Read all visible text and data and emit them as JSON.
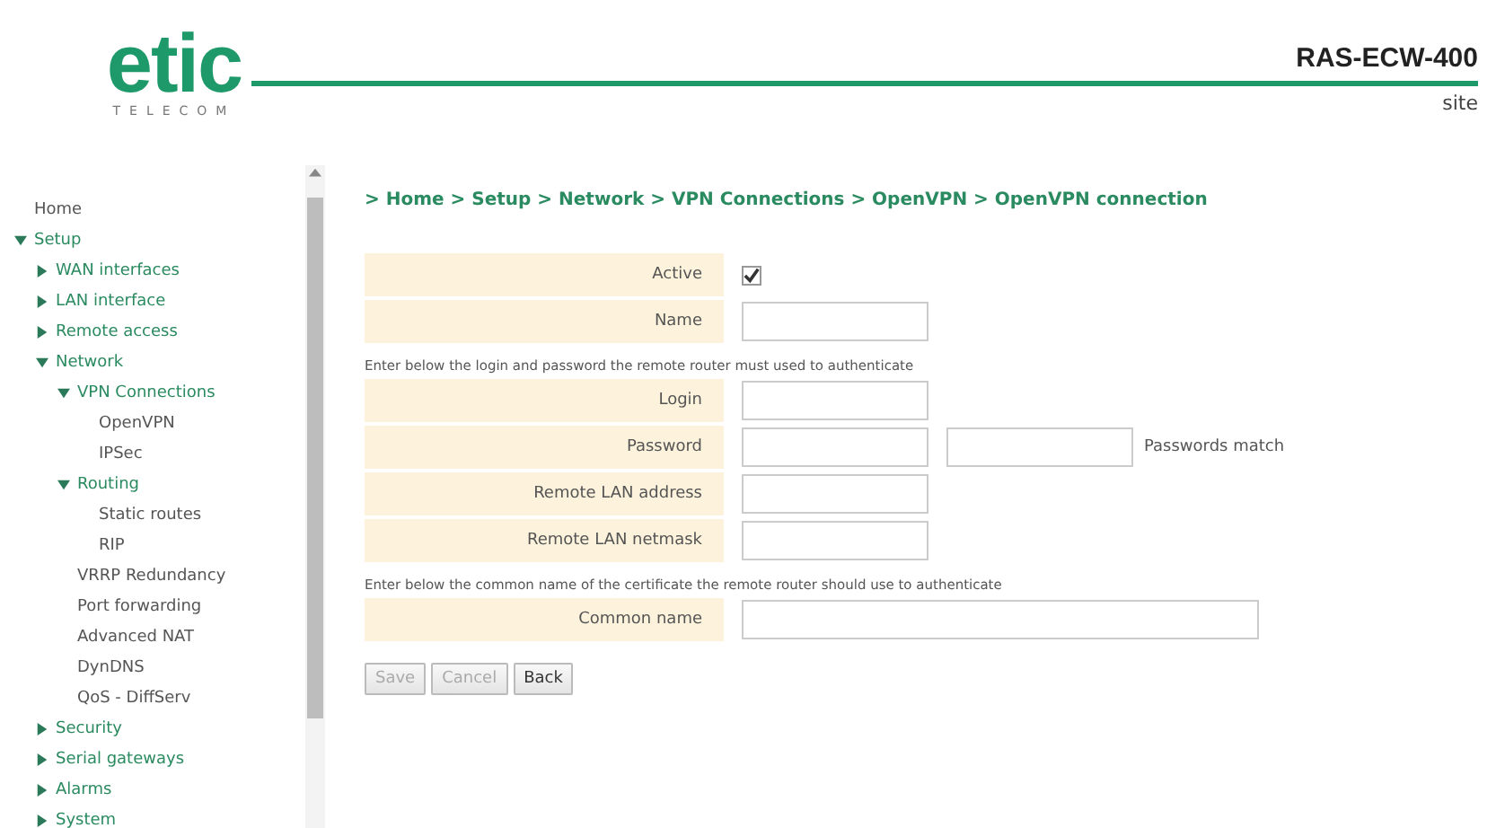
{
  "header": {
    "logo": {
      "word": "etic",
      "subtitle": "TELECOM"
    },
    "device": "RAS-ECW-400",
    "site": "site"
  },
  "sidebar": {
    "items": [
      {
        "label": "Home",
        "kind": "page"
      },
      {
        "label": "Setup",
        "kind": "folder",
        "expanded": true,
        "children": [
          {
            "label": "WAN interfaces",
            "kind": "folder",
            "expanded": false
          },
          {
            "label": "LAN interface",
            "kind": "folder",
            "expanded": false
          },
          {
            "label": "Remote access",
            "kind": "folder",
            "expanded": false
          },
          {
            "label": "Network",
            "kind": "folder",
            "expanded": true,
            "children": [
              {
                "label": "VPN Connections",
                "kind": "folder",
                "expanded": true,
                "children": [
                  {
                    "label": "OpenVPN",
                    "kind": "page"
                  },
                  {
                    "label": "IPSec",
                    "kind": "page"
                  }
                ]
              },
              {
                "label": "Routing",
                "kind": "folder",
                "expanded": true,
                "children": [
                  {
                    "label": "Static routes",
                    "kind": "page"
                  },
                  {
                    "label": "RIP",
                    "kind": "page"
                  }
                ]
              },
              {
                "label": "VRRP Redundancy",
                "kind": "page"
              },
              {
                "label": "Port forwarding",
                "kind": "page"
              },
              {
                "label": "Advanced NAT",
                "kind": "page"
              },
              {
                "label": "DynDNS",
                "kind": "page"
              },
              {
                "label": "QoS - DiffServ",
                "kind": "page"
              }
            ]
          },
          {
            "label": "Security",
            "kind": "folder",
            "expanded": false
          },
          {
            "label": "Serial gateways",
            "kind": "folder",
            "expanded": false
          },
          {
            "label": "Alarms",
            "kind": "folder",
            "expanded": false
          },
          {
            "label": "System",
            "kind": "folder",
            "expanded": false
          }
        ]
      }
    ]
  },
  "breadcrumb": "> Home > Setup > Network > VPN Connections > OpenVPN > OpenVPN connection",
  "form": [
    {
      "kind": "checkbox",
      "label": "Active",
      "checked": true
    },
    {
      "kind": "field",
      "label": "Name"
    },
    {
      "kind": "note",
      "text": "Enter below the login and password the remote router must used to authenticate"
    },
    {
      "kind": "field",
      "label": "Login"
    },
    {
      "kind": "password",
      "label": "Password",
      "status": "Passwords match"
    },
    {
      "kind": "field",
      "label": "Remote LAN address"
    },
    {
      "kind": "field",
      "label": "Remote LAN netmask"
    },
    {
      "kind": "note",
      "text": "Enter below the common name of the certificate the remote router should use to authenticate"
    },
    {
      "kind": "wide",
      "label": "Common name"
    }
  ],
  "buttons": [
    {
      "label": "Save",
      "disabled": true
    },
    {
      "label": "Cancel",
      "disabled": true
    },
    {
      "label": "Back",
      "disabled": false
    }
  ]
}
